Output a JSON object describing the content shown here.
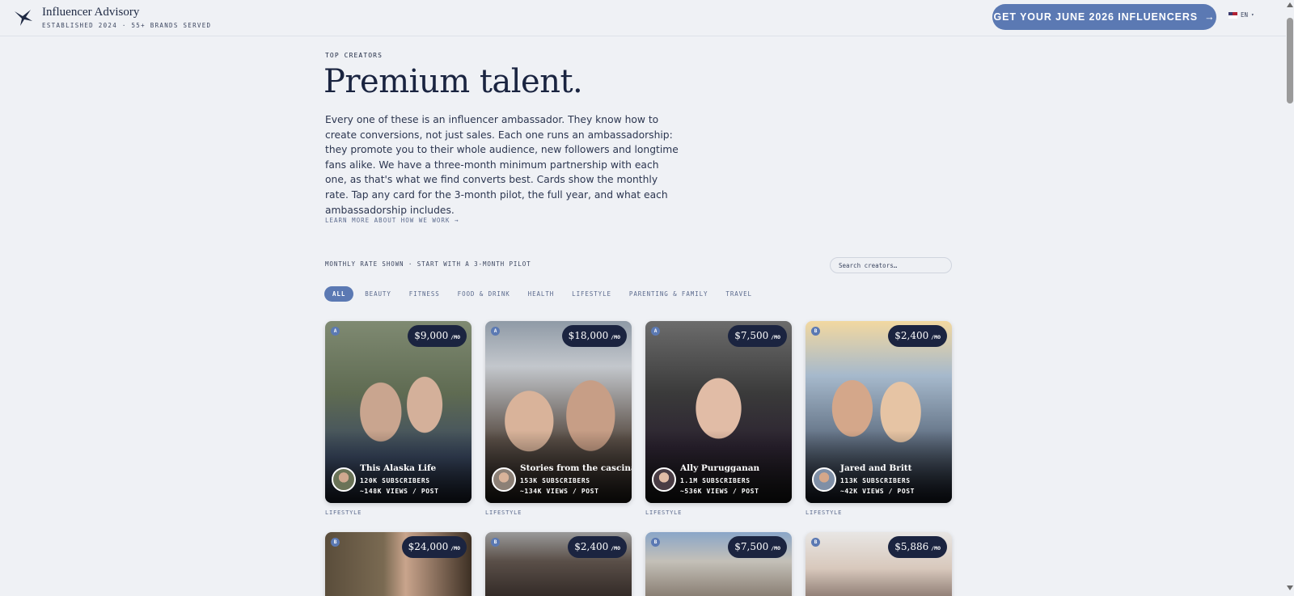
{
  "header": {
    "brand_name": "Influencer Advisory",
    "brand_tagline": "ESTABLISHED 2024 · 55+ BRANDS SERVED",
    "cta_label": "GET YOUR JUNE 2026 INFLUENCERS",
    "cta_arrow": "→",
    "language": "EN",
    "language_caret": "▾"
  },
  "intro": {
    "eyebrow": "TOP CREATORS",
    "title": "Premium talent.",
    "body": "Every one of these is an influencer ambassador. They know how to create conversions, not just sales. Each one runs an ambassadorship: they promote you to their whole audience, new followers and longtime fans alike. We have a three-month minimum partnership with each one, as that's what we find converts best. Cards show the monthly rate. Tap any card for the 3-month pilot, the full year, and what each ambassadorship includes.",
    "learn_more": "LEARN MORE ABOUT HOW WE WORK →"
  },
  "filters": {
    "rate_note": "MONTHLY RATE SHOWN · START WITH A 3-MONTH PILOT",
    "search_placeholder": "Search creators…",
    "categories": [
      "ALL",
      "BEAUTY",
      "FITNESS",
      "FOOD & DRINK",
      "HEALTH",
      "LIFESTYLE",
      "PARENTING & FAMILY",
      "TRAVEL"
    ],
    "active_category": "ALL"
  },
  "price_unit": "/MO",
  "creators": [
    {
      "tier": "A",
      "price": "$9,000",
      "name": "This Alaska Life",
      "subscribers": "120K SUBSCRIBERS",
      "views": "~148K VIEWS / POST",
      "category": "LIFESTYLE"
    },
    {
      "tier": "A",
      "price": "$18,000",
      "name": "Stories from the cascina",
      "subscribers": "153K SUBSCRIBERS",
      "views": "~134K VIEWS / POST",
      "category": "LIFESTYLE"
    },
    {
      "tier": "A",
      "price": "$7,500",
      "name": "Ally Purugganan",
      "subscribers": "1.1M SUBSCRIBERS",
      "views": "~536K VIEWS / POST",
      "category": "LIFESTYLE"
    },
    {
      "tier": "B",
      "price": "$2,400",
      "name": "Jared and Britt",
      "subscribers": "113K SUBSCRIBERS",
      "views": "~42K VIEWS / POST",
      "category": "LIFESTYLE"
    },
    {
      "tier": "B",
      "price": "$24,000"
    },
    {
      "tier": "B",
      "price": "$2,400"
    },
    {
      "tier": "B",
      "price": "$7,500"
    },
    {
      "tier": "B",
      "price": "$5,886"
    }
  ],
  "colors": {
    "accent": "#5b79b3",
    "background": "#eff1f5",
    "navy": "#1b2440"
  }
}
